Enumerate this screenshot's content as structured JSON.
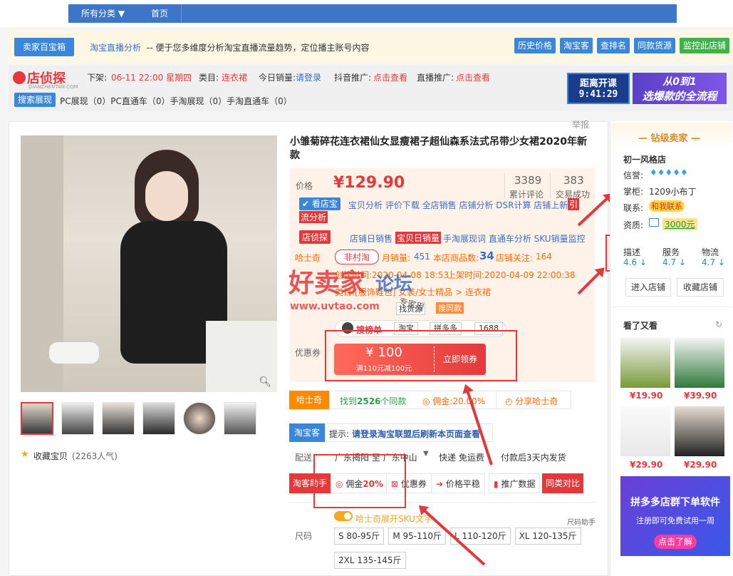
{
  "topnav": {
    "all_categories": "所有分类",
    "home": "首页"
  },
  "plugin": {
    "brand": "卖家百宝箱",
    "tool_name": "淘宝直播分析",
    "tool_desc": "-- 便于您多维度分析淘宝直播流量趋势，定位播主账号内容",
    "buttons": [
      "历史价格",
      "淘宝客",
      "查排名",
      "同款货源"
    ],
    "monitor": "监控此店铺"
  },
  "dt": {
    "logo": "店侦探",
    "logo_sub": "DIANZHENTAN.COM",
    "offshelf_label": "下架:",
    "offshelf_value": "06-11 22:00 星期四",
    "category_label": "类目:",
    "category_value": "连衣裙",
    "today_sales_label": "今日销量:",
    "today_sales_value": "请登录",
    "douyin_label": "抖音推广:",
    "douyin_value": "点击查看",
    "live_label": "直播推广:",
    "live_value": "点击查看",
    "search_show": "搜索展现",
    "counts": "PC展现（0）PC直通车（0）手淘展现（0）手淘直通车（0）",
    "ad1_top": "距离开课",
    "ad1_time": "9:41:29",
    "ad2_line1": "从0到1",
    "ad2_line2": "选爆款的全流程"
  },
  "product": {
    "report": "举报",
    "title": "小雏菊碎花连衣裙仙女显瘦裙子超仙森系法式吊带少女裙2020年新款",
    "price_label": "价格",
    "price": "¥129.90",
    "reviews_num": "3389",
    "reviews_label": "累计评论",
    "deals_num": "383",
    "deals_label": "交易成功",
    "kdb_label": "看店宝",
    "kdb_links": "宝贝分析 评价下载 全店销售 店铺分析 DSR计算 店铺上新",
    "kdb_tail": "引",
    "kdb_tail2": "流分析",
    "dt_label": "店侦探",
    "dt_links1": "店铺日销售",
    "dt_links2": "宝贝日销量",
    "dt_links3": "手淘展现词 直通车分析 SKU销量监控",
    "hsq": "哈士奇",
    "village": "非村淘",
    "monthly_label": "月销量:",
    "monthly_value": "451",
    "store_count_label": "本店商品数:",
    "store_count_value": "34",
    "store_follow_label": "店铺关注:",
    "store_follow_value": "164",
    "created": "创建时间:2020-04-08 18:53",
    "listed": "上架时间:2020-04-09 22:00:38",
    "category_path": "类目:[服饰鞋包] 女装/女士精品 > 连衣裙",
    "find_goods": "找货源",
    "same_style": "搜同款",
    "rank": "搜榜单",
    "platforms": [
      "淘宝",
      "拼多多",
      "1688"
    ],
    "coupon_label": "优惠券",
    "coupon_amount": "¥ 100",
    "coupon_rule": "满110元减100元",
    "coupon_btn": "立即领券",
    "hsq_tab": "哈士奇",
    "find_same_pre": "找到",
    "find_same_num": "2526",
    "find_same_post": "个同款",
    "commission": "佣金:20.00%",
    "share": "分享哈士奇",
    "tbk_label": "淘宝客",
    "tip_pre": "提示: ",
    "tip_text": "请登录淘宝联盟后刷新本页面查看",
    "ship_label": "配送",
    "ship_route": "广东揭阳 至 广东中山",
    "ship_fee": "快递 免运费",
    "ship_time": "付款后3天内发货",
    "tkzs": "淘客助手",
    "tk_commission_pre": "佣金",
    "tk_commission_val": "20%",
    "tk_coupon": "优惠券",
    "tk_price": "价格平稳",
    "tk_promo": "推广数据",
    "tk_compare": "同类对比",
    "sku_toggle": "哈士奇展开SKU文字",
    "size_helper": "尺码助手",
    "size_label": "尺码",
    "sizes": [
      "S 80-95斤",
      "M 95-110斤",
      "L 110-120斤",
      "XL 120-135斤",
      "2XL 135-145斤"
    ],
    "fav": "收藏宝贝",
    "fav_count": "(2263人气)",
    "watermark1": "好卖家",
    "watermark2": "论坛",
    "watermark_url": "www.uvtao.com",
    "watermark_stamp": "专家用"
  },
  "seller": {
    "badge": "钻级卖家",
    "shop_name": "初一风格店",
    "credit_label": "信誉:",
    "keeper_label": "掌柜:",
    "keeper_value": "1209小布丁",
    "contact_label": "联系:",
    "contact_value": "和我联系",
    "capital_label": "资质:",
    "capital_value": "3000元",
    "scores": [
      {
        "label": "描述",
        "value": "4.6"
      },
      {
        "label": "服务",
        "value": "4.7"
      },
      {
        "label": "物流",
        "value": "4.7"
      }
    ],
    "enter_shop": "进入店铺",
    "fav_shop": "收藏店铺",
    "see_more": "看了又看",
    "recs": [
      {
        "price": "¥19.90"
      },
      {
        "price": "¥39.90"
      },
      {
        "price": "¥29.90"
      },
      {
        "price": "¥29.90"
      }
    ],
    "ad_title": "拼多多店群下单软件",
    "ad_sub": "注册即可免费试用一周",
    "ad_btn": "点击了解"
  },
  "colors": {
    "accent": "#e4393c",
    "brand_blue": "#3d76c8",
    "price": "#e4393c"
  }
}
